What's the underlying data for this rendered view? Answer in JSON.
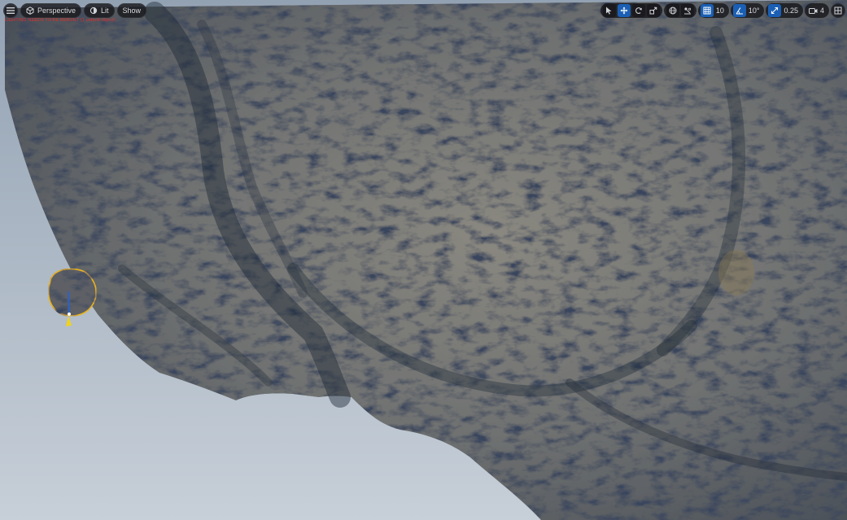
{
  "viewport": {
    "view_mode": "Perspective",
    "lighting_mode": "Lit",
    "show_label": "Show",
    "warning_text": "LIGHTING NEEDS TO BE REBUILT (1 unbuilt object)",
    "grid_snap_value": "10",
    "rotation_snap_value": "10°",
    "scale_snap_value": "0.25",
    "camera_speed_value": "4"
  },
  "icons": {
    "menu": "hamburger-menu-icon",
    "perspective": "cube-icon",
    "lit": "sun-icon",
    "select": "arrow-select-icon",
    "translate": "move-icon",
    "rotate": "rotate-icon",
    "scale": "scale-icon",
    "world": "globe-icon",
    "surface_snap": "surface-snap-icon",
    "grid": "grid-icon",
    "rotation": "angle-icon",
    "scale_snap": "scale-snap-icon",
    "camera": "camera-icon",
    "layout": "layout-icon"
  },
  "colors": {
    "active_accent": "#1a5fb4",
    "warning": "#e0302a",
    "selection_outline": "#e8b21a"
  }
}
